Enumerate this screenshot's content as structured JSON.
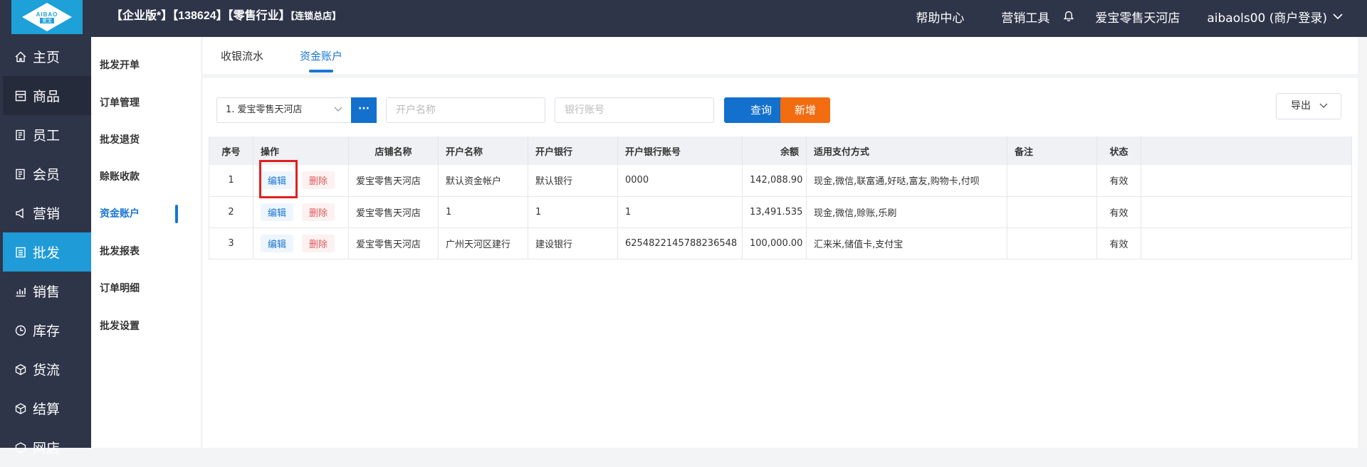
{
  "header": {
    "logo_text": "AIBAO",
    "logo_sub": "爱宝",
    "title_main": "【企业版*】【138624】【零售行业】",
    "title_small": "【连锁总店】",
    "help": "帮助中心",
    "marketing_tools": "营销工具",
    "store_name": "爱宝零售天河店",
    "user": "aibaols00 (商户登录)"
  },
  "main_nav": [
    {
      "label": "主页",
      "icon": "home-icon"
    },
    {
      "label": "商品",
      "icon": "product-icon"
    },
    {
      "label": "员工",
      "icon": "staff-icon"
    },
    {
      "label": "会员",
      "icon": "member-icon"
    },
    {
      "label": "营销",
      "icon": "marketing-icon"
    },
    {
      "label": "批发",
      "icon": "wholesale-icon"
    },
    {
      "label": "销售",
      "icon": "sales-chart-icon"
    },
    {
      "label": "库存",
      "icon": "inventory-icon"
    },
    {
      "label": "货流",
      "icon": "cube-icon"
    },
    {
      "label": "结算",
      "icon": "settle-icon"
    },
    {
      "label": "网店",
      "icon": "shop-icon"
    }
  ],
  "sub_nav": [
    "批发开单",
    "订单管理",
    "批发退货",
    "赊账收款",
    "资金账户",
    "批发报表",
    "订单明细",
    "批发设置"
  ],
  "tabs": [
    "收银流水",
    "资金账户"
  ],
  "filters": {
    "store_value": "1. 爱宝零售天河店",
    "account_name_placeholder": "开户名称",
    "bank_account_placeholder": "银行账号",
    "dots": "···",
    "query": "查询",
    "add": "新增",
    "export": "导出"
  },
  "table": {
    "headers": [
      "序号",
      "操作",
      "店铺名称",
      "开户名称",
      "开户银行",
      "开户银行账号",
      "余额",
      "适用支付方式",
      "备注",
      "状态"
    ],
    "edit_label": "编辑",
    "delete_label": "删除",
    "rows": [
      {
        "no": "1",
        "store": "爱宝零售天河店",
        "account_name": "默认资金帐户",
        "bank": "默认银行",
        "account_no": "0000",
        "balance": "142,088.90",
        "pay_methods": "现金,微信,联富通,好哒,富友,购物卡,付呗",
        "remark": "",
        "status": "有效"
      },
      {
        "no": "2",
        "store": "爱宝零售天河店",
        "account_name": "1",
        "bank": "1",
        "account_no": "1",
        "balance": "13,491.535",
        "pay_methods": "现金,微信,赊账,乐刷",
        "remark": "",
        "status": "有效"
      },
      {
        "no": "3",
        "store": "爱宝零售天河店",
        "account_name": "广州天河区建行",
        "bank": "建设银行",
        "account_no": "6254822145788236548",
        "balance": "100,000.00",
        "pay_methods": "汇来米,储值卡,支付宝",
        "remark": "",
        "status": "有效"
      }
    ]
  }
}
